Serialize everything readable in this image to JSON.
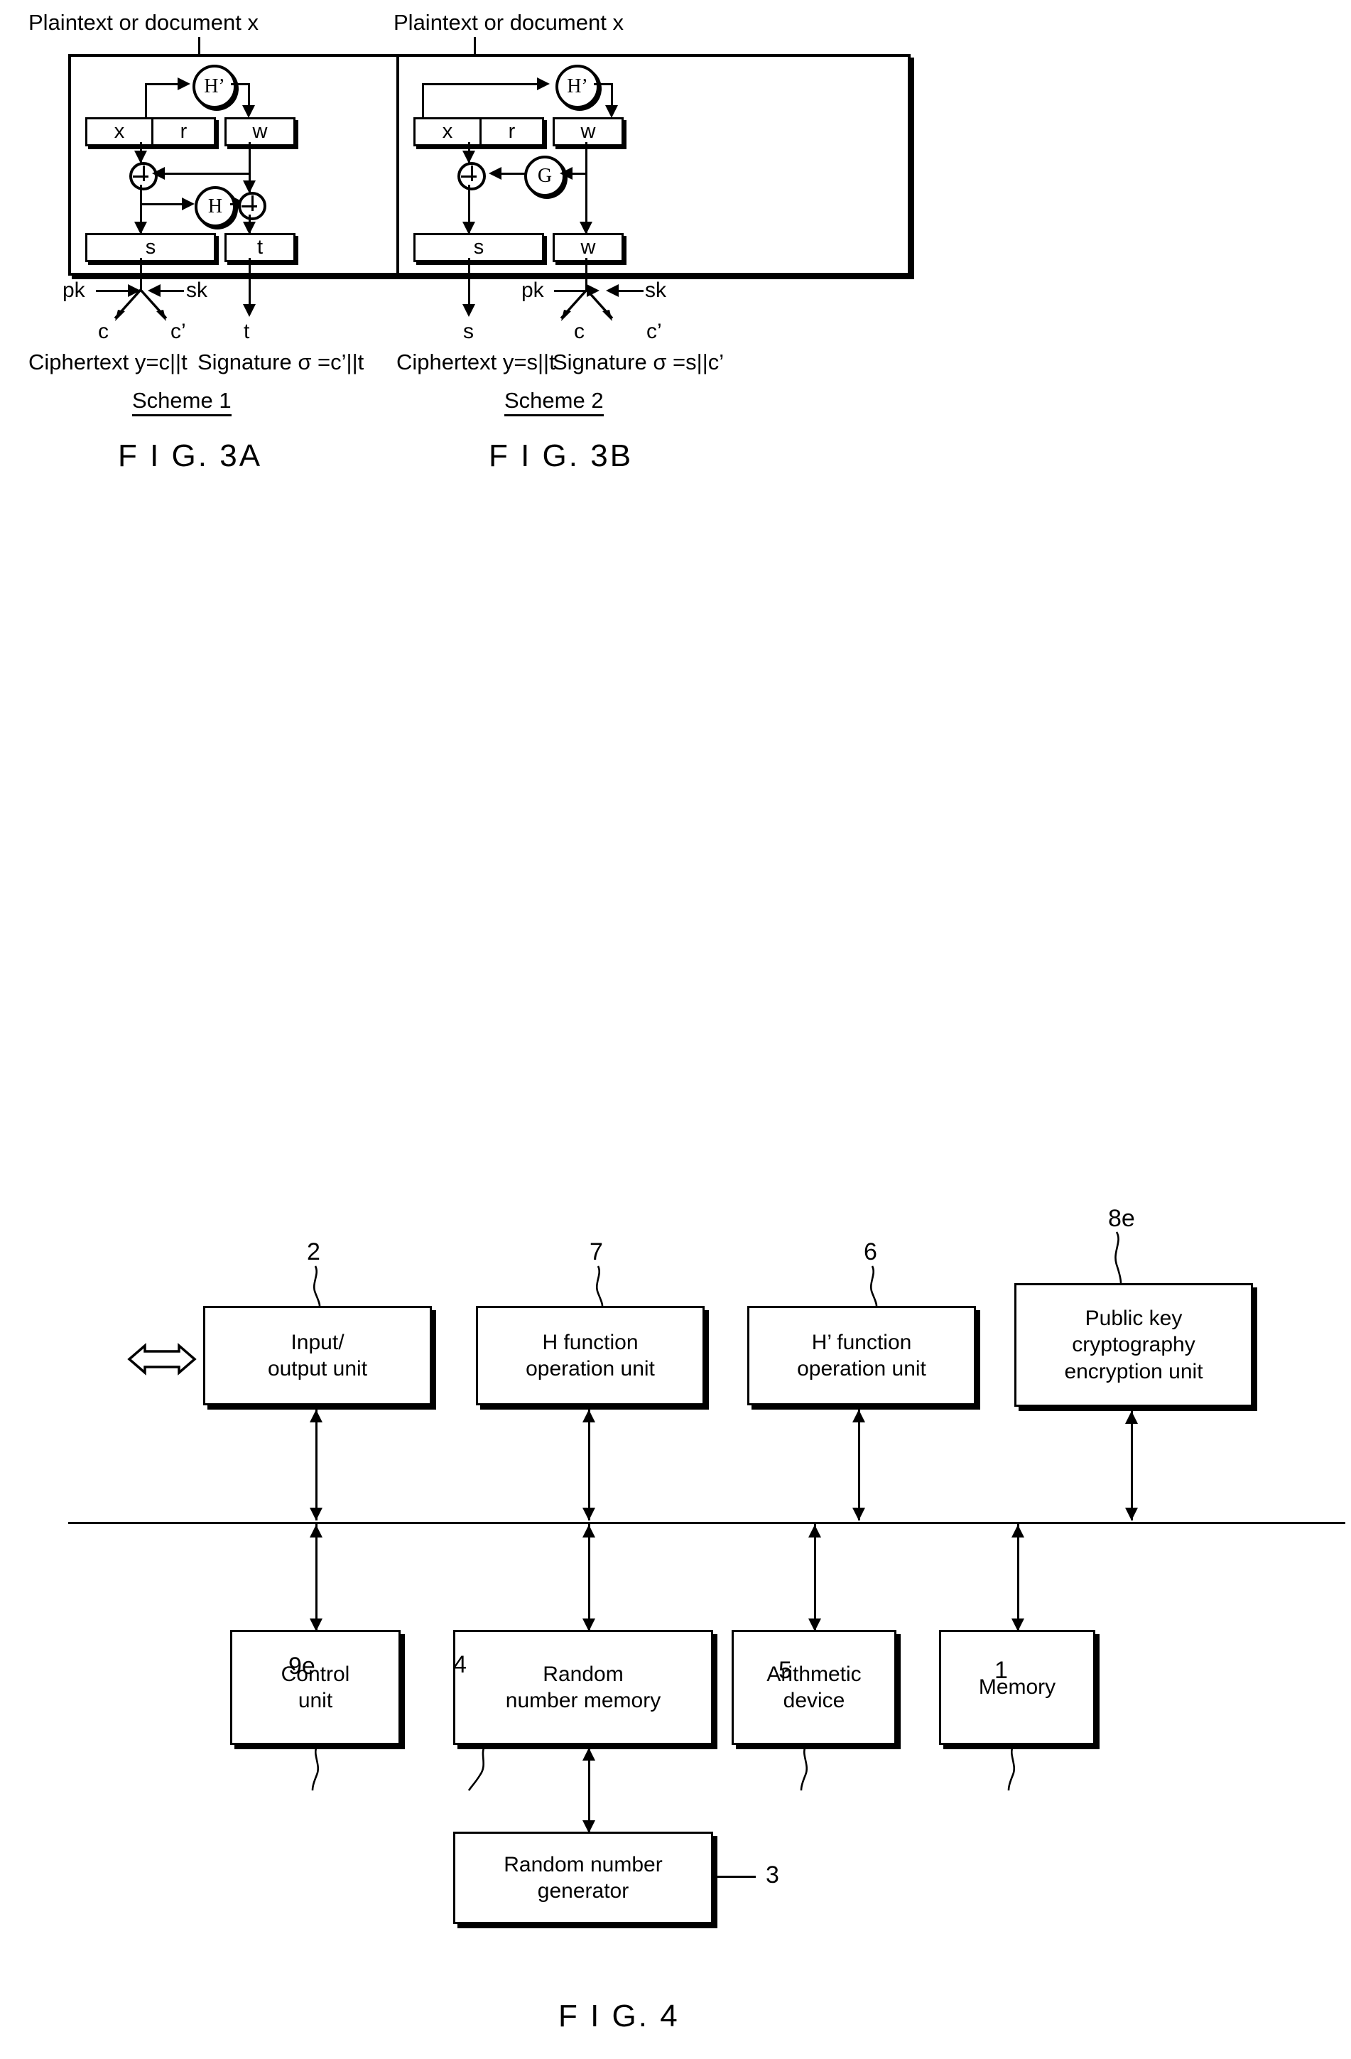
{
  "figures": {
    "fig3a": {
      "top_label": "Plaintext or document x",
      "registers_top": [
        {
          "label": "x"
        },
        {
          "label": "r"
        },
        {
          "label": "w"
        }
      ],
      "registers_bottom": [
        {
          "label": "s"
        },
        {
          "label": "t"
        }
      ],
      "functions": [
        {
          "label": "H’"
        },
        {
          "label": "H"
        }
      ],
      "operators": [
        {
          "label": "⊕"
        },
        {
          "label": "⊕"
        }
      ],
      "keys": {
        "public": "pk",
        "secret": "sk"
      },
      "outputs": [
        {
          "label": "c"
        },
        {
          "label": "c’"
        },
        {
          "label": "t"
        }
      ],
      "caption_ciphertext": "Ciphertext y=c||t",
      "caption_signature": "Signature σ =c’||t",
      "scheme_name": "Scheme 1",
      "fig_label": "F I G. 3A"
    },
    "fig3b": {
      "top_label": "Plaintext or document x",
      "registers_top": [
        {
          "label": "x"
        },
        {
          "label": "r"
        },
        {
          "label": "w"
        }
      ],
      "registers_bottom": [
        {
          "label": "s"
        },
        {
          "label": "w"
        }
      ],
      "functions": [
        {
          "label": "H’"
        },
        {
          "label": "G"
        }
      ],
      "operators": [
        {
          "label": "⊕"
        }
      ],
      "keys": {
        "public": "pk",
        "secret": "sk"
      },
      "outputs": [
        {
          "label": "s"
        },
        {
          "label": "c"
        },
        {
          "label": "c’"
        }
      ],
      "caption_ciphertext": "Ciphertext y=s||t",
      "caption_signature": "Signature σ =s||c’",
      "scheme_name": "Scheme 2",
      "fig_label": "F I G. 3B"
    },
    "fig4": {
      "fig_label": "F I G. 4",
      "top_row": [
        {
          "lines": [
            "Input/",
            "output unit"
          ],
          "ref": "2"
        },
        {
          "lines": [
            "H function",
            "operation unit"
          ],
          "ref": "7"
        },
        {
          "lines": [
            "H’ function",
            "operation unit"
          ],
          "ref": "6"
        },
        {
          "lines": [
            "Public key",
            "cryptography",
            "encryption unit"
          ],
          "ref": "8e"
        }
      ],
      "bottom_row": [
        {
          "lines": [
            "Control",
            "unit"
          ],
          "ref": "9e"
        },
        {
          "lines": [
            "Random",
            "number memory"
          ],
          "ref": "4"
        },
        {
          "lines": [
            "Arithmetic",
            "device"
          ],
          "ref": "5"
        },
        {
          "lines": [
            "Memory"
          ],
          "ref": "1"
        }
      ],
      "generator": {
        "lines": [
          "Random number",
          "generator"
        ],
        "ref": "3"
      }
    }
  }
}
